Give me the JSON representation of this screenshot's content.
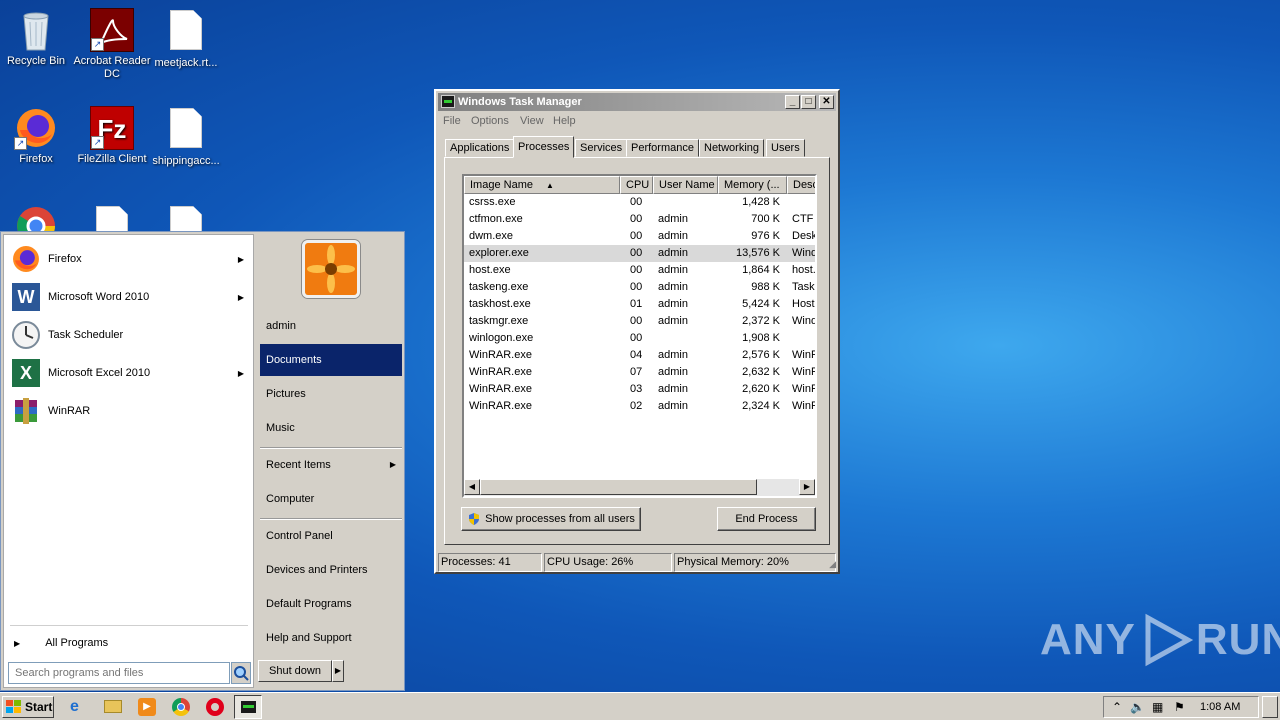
{
  "desktop": {
    "icons": [
      {
        "label": "Recycle Bin",
        "icon": "recycle-bin-icon"
      },
      {
        "label": "Acrobat Reader DC",
        "icon": "acrobat-icon"
      },
      {
        "label": "meetjack.rt...",
        "icon": "document-icon"
      },
      {
        "label": "Firefox",
        "icon": "firefox-icon"
      },
      {
        "label": "FileZilla Client",
        "icon": "filezilla-icon"
      },
      {
        "label": "shippingacc...",
        "icon": "document-icon"
      }
    ]
  },
  "start_menu": {
    "programs": [
      {
        "label": "Firefox",
        "has_submenu": true
      },
      {
        "label": "Microsoft Word 2010",
        "has_submenu": true
      },
      {
        "label": "Task Scheduler",
        "has_submenu": false
      },
      {
        "label": "Microsoft Excel 2010",
        "has_submenu": true
      },
      {
        "label": "WinRAR",
        "has_submenu": false
      }
    ],
    "all_programs": "All Programs",
    "search_placeholder": "Search programs and files",
    "right_items": [
      {
        "label": "admin"
      },
      {
        "label": "Documents"
      },
      {
        "label": "Pictures"
      },
      {
        "label": "Music"
      },
      {
        "label": "Recent Items"
      },
      {
        "label": "Computer"
      },
      {
        "label": "Control Panel"
      },
      {
        "label": "Devices and Printers"
      },
      {
        "label": "Default Programs"
      },
      {
        "label": "Help and Support"
      }
    ],
    "shutdown_label": "Shut down"
  },
  "task_manager": {
    "title": "Windows Task Manager",
    "menus": [
      "File",
      "Options",
      "View",
      "Help"
    ],
    "tabs": [
      "Applications",
      "Processes",
      "Services",
      "Performance",
      "Networking",
      "Users"
    ],
    "active_tab": "Processes",
    "columns": [
      "Image Name",
      "CPU",
      "User Name",
      "Memory (...",
      "Desc"
    ],
    "processes": [
      {
        "name": "csrss.exe",
        "cpu": "00",
        "user": "",
        "memory": "1,428 K",
        "desc": ""
      },
      {
        "name": "ctfmon.exe",
        "cpu": "00",
        "user": "admin",
        "memory": "700 K",
        "desc": "CTF L"
      },
      {
        "name": "dwm.exe",
        "cpu": "00",
        "user": "admin",
        "memory": "976 K",
        "desc": "Deskt"
      },
      {
        "name": "explorer.exe",
        "cpu": "00",
        "user": "admin",
        "memory": "13,576 K",
        "desc": "Wind"
      },
      {
        "name": "host.exe",
        "cpu": "00",
        "user": "admin",
        "memory": "1,864 K",
        "desc": "host."
      },
      {
        "name": "taskeng.exe",
        "cpu": "00",
        "user": "admin",
        "memory": "988 K",
        "desc": "Task"
      },
      {
        "name": "taskhost.exe",
        "cpu": "01",
        "user": "admin",
        "memory": "5,424 K",
        "desc": "Host"
      },
      {
        "name": "taskmgr.exe",
        "cpu": "00",
        "user": "admin",
        "memory": "2,372 K",
        "desc": "Wind"
      },
      {
        "name": "winlogon.exe",
        "cpu": "00",
        "user": "",
        "memory": "1,908 K",
        "desc": ""
      },
      {
        "name": "WinRAR.exe",
        "cpu": "04",
        "user": "admin",
        "memory": "2,576 K",
        "desc": "WinR"
      },
      {
        "name": "WinRAR.exe",
        "cpu": "07",
        "user": "admin",
        "memory": "2,632 K",
        "desc": "WinR"
      },
      {
        "name": "WinRAR.exe",
        "cpu": "03",
        "user": "admin",
        "memory": "2,620 K",
        "desc": "WinR"
      },
      {
        "name": "WinRAR.exe",
        "cpu": "02",
        "user": "admin",
        "memory": "2,324 K",
        "desc": "WinR"
      }
    ],
    "selected_process": "explorer.exe",
    "show_all_label": "Show processes from all users",
    "end_process_label": "End Process",
    "status": {
      "processes": "Processes: 41",
      "cpu": "CPU Usage: 26%",
      "memory": "Physical Memory: 20%"
    }
  },
  "taskbar": {
    "start_label": "Start",
    "clock": "1:08 AM",
    "pinned": [
      "ie-icon",
      "explorer-folder-icon",
      "media-player-icon",
      "chrome-icon",
      "opera-icon",
      "task-manager-icon"
    ]
  },
  "watermark": {
    "text_left": "ANY",
    "text_right": "RUN"
  }
}
